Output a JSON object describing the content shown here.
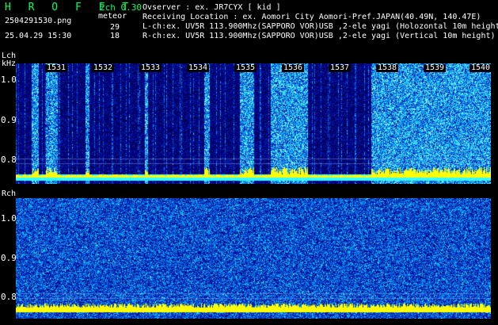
{
  "header": {
    "app_name": "H R O F F T",
    "version": "2ch 0.30",
    "filename": "2504291530.png",
    "meteor_label": "meteor",
    "datetime": "25.04.29 15:30",
    "count_lch": "29",
    "count_rch": "18"
  },
  "info": {
    "observer": "Ovserver            : ex. JR7CYX [ kid ]",
    "location": "Receiving Location : ex. Aomori City Aomori-Pref.JAPAN(40.49N, 140.47E)",
    "lch": "L-ch:ex. UV5R 113.900Mhz(SAPPORO VOR)USB ,2-ele yagi (Holozontal 10m height",
    "rch": "R-ch:ex. UV5R 113.900Mhz(SAPPORO VOR)USB ,2-ele yagi (Vertical 10m height)"
  },
  "lch": {
    "label": "Lch",
    "unit": "kHz",
    "y_labels": [
      "1.0",
      "0.9",
      "0.8"
    ],
    "time_labels": [
      "1531",
      "1532",
      "1533",
      "1534",
      "1535",
      "1536",
      "1537",
      "1538",
      "1539",
      "1540"
    ]
  },
  "rch": {
    "label": "Rch",
    "y_labels": [
      "1.0",
      "0.9",
      "0.8"
    ]
  },
  "colors": {
    "background": "#000000",
    "accent": "#00ff66",
    "trace": "#ffff00",
    "noise_low": "#000055",
    "noise_high": "#33ffff"
  }
}
